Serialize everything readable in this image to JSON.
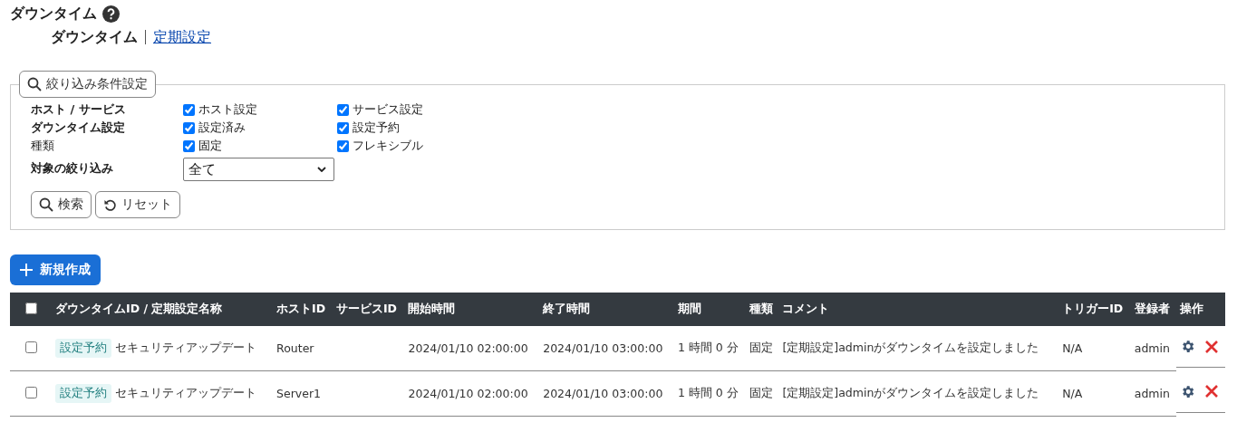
{
  "page": {
    "title": "ダウンタイム",
    "nav": [
      {
        "label": "ダウンタイム",
        "selected": true
      },
      {
        "label": "定期設定",
        "selected": false
      }
    ]
  },
  "filter": {
    "legend": "絞り込み条件設定",
    "rows": [
      {
        "label": "ホスト / サービス",
        "bold": true,
        "options": [
          {
            "label": "ホスト設定",
            "checked": true
          },
          {
            "label": "サービス設定",
            "checked": true
          }
        ]
      },
      {
        "label": "ダウンタイム設定",
        "bold": true,
        "options": [
          {
            "label": "設定済み",
            "checked": true
          },
          {
            "label": "設定予約",
            "checked": true
          }
        ]
      },
      {
        "label": "種類",
        "bold": false,
        "options": [
          {
            "label": "固定",
            "checked": true
          },
          {
            "label": "フレキシブル",
            "checked": true
          }
        ]
      }
    ],
    "target": {
      "label": "対象の絞り込み",
      "value": "全て"
    },
    "buttons": [
      {
        "label": "検索",
        "kind": "search"
      },
      {
        "label": "リセット",
        "kind": "reset"
      }
    ]
  },
  "create_button": {
    "label": "新規作成"
  },
  "table": {
    "select_all": {
      "checked": false
    },
    "columns": [
      "ダウンタイムID / 定期設定名称",
      "ホストID",
      "サービスID",
      "開始時間",
      "終了時間",
      "期間",
      "種類",
      "コメント",
      "トリガーID",
      "登録者",
      "操作"
    ],
    "rows": [
      {
        "checked": false,
        "tag": "設定予約",
        "name": "セキュリティアップデート",
        "host": "Router",
        "service": "",
        "start": "2024/01/10 02:00:00",
        "end": "2024/01/10 03:00:00",
        "period": "1 時間 0 分",
        "type": "固定",
        "comment": "[定期設定]adminがダウンタイムを設定しました",
        "trigger": "N/A",
        "user": "admin"
      },
      {
        "checked": false,
        "tag": "設定予約",
        "name": "セキュリティアップデート",
        "host": "Server1",
        "service": "",
        "start": "2024/01/10 02:00:00",
        "end": "2024/01/10 03:00:00",
        "period": "1 時間 0 分",
        "type": "固定",
        "comment": "[定期設定]adminがダウンタイムを設定しました",
        "trigger": "N/A",
        "user": "admin"
      }
    ]
  }
}
